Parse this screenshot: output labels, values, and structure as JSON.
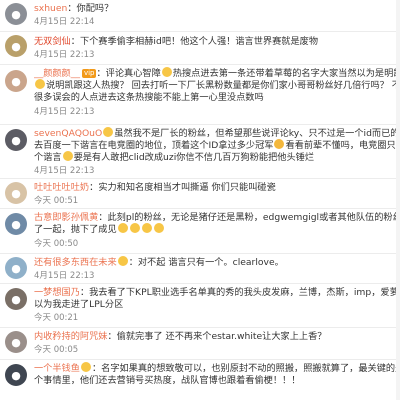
{
  "comments": [
    {
      "username": "sxhuen",
      "name_style": "normal",
      "lines": [
        "你配吗？"
      ],
      "time": "4月15日 22:14",
      "avatar_color": "#8b8f96",
      "avatar_icon": "user-avatar"
    },
    {
      "username": "无双剑仙",
      "name_style": "red",
      "lines": [
        "下个赛季偷李相赫id吧！他这个人强！谐言世界赛就是废物"
      ],
      "time": "4月15日 22:13",
      "avatar_color": "#b9a06a",
      "avatar_icon": "user-avatar"
    },
    {
      "username": "__颜颜颜__",
      "name_style": "normal",
      "vip": "vip",
      "lines": [
        "评论真心智障",
        "热搜点进去第一条还带着草莓的名字大家当然以为是明凯啊",
        "说明凯跟这人热搜？ 回去打听一下厂长黑粉数量都是你们家小哥哥粉丝好几倍行吗？ 不是",
        "很多误会的人点进去这条热搜能不能上第一心里没点数吗"
      ],
      "time": "4月15日 22:13",
      "avatar_color": "#caa58c",
      "avatar_icon": "user-avatar"
    },
    {
      "username": "sevenQAQOuO",
      "name_style": "normal",
      "lines": [
        "虽然我不是厂长的粉丝，但希望那些说评论ky、只不过是一个id而已的人",
        "去百度一下谐言在电竞圈的地位，顶着这个ID拿过多少冠军",
        "看看前辈不懂吗，电竞圈只能有一",
        "个谐言",
        "要是有人敢把clid改成uzi你信不信几百万狗粉能把他头锤烂"
      ],
      "time": "4月15日 22:13",
      "avatar_color": "#5c5c64",
      "avatar_icon": "user-avatar"
    },
    {
      "username": "吐吐吐吐吐奶",
      "name_style": "normal",
      "lines": [
        "实力和知名度相当才叫撕逼 你们只能叫碰瓷"
      ],
      "time": "今天 00:51",
      "avatar_color": "#d8c3a6",
      "avatar_icon": "user-avatar"
    },
    {
      "username": "古意即影孙佩黄",
      "name_style": "normal",
      "lines": [
        "此刻pl的粉丝，无论是猪仔还是黑粉，edgwemgigl或者其他队伍的粉丝，都站在",
        "了一起，抛下了成见"
      ],
      "time": "今天 00:50",
      "avatar_color": "#6f8aa6",
      "avatar_icon": "user-avatar"
    },
    {
      "username": "还有很多东西在未来",
      "name_style": "normal",
      "lines": [
        "：对不起 谐言只有一个。clearlove。"
      ],
      "time": "4月15日 22:13",
      "avatar_color": "#8fb0c9",
      "avatar_icon": "user-avatar"
    },
    {
      "username": "一梦想国乃",
      "name_style": "normal",
      "lines": [
        "我去看了下KPL职业选手名单真的秀的我头皮发麻，兰博，杰斯，imp，爱萝莉，我",
        "以为我走进了LPL分区"
      ],
      "time": "今天 00:21",
      "avatar_color": "#7a6f66",
      "avatar_icon": "user-avatar"
    },
    {
      "username": "内收矜持的阿咒妹",
      "name_style": "normal",
      "lines": [
        "偷就完事了 还不再来个estar.white让大家上上香？"
      ],
      "time": "今天 00:05",
      "avatar_color": "#9a8f8a",
      "avatar_icon": "user-avatar"
    },
    {
      "username": "一个半钱鱼",
      "name_style": "normal",
      "lines": [
        "名字如果真的想致敬可以，也别原封不动的照搬，照搬就算了，最关键的是这",
        "个事情里，他们还去营销号买热度，战队官博也跟着看偷梗！！！"
      ],
      "time": "",
      "avatar_color": "#3f4651",
      "avatar_icon": "user-avatar"
    }
  ]
}
